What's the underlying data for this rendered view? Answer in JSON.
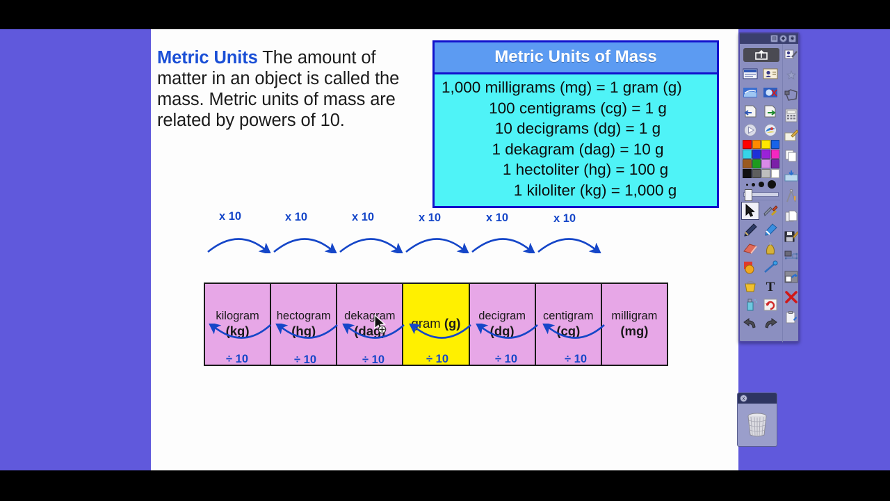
{
  "slide": {
    "paragraph": {
      "lead": "Metric Units",
      "body": "The amount of matter in an object is called the mass. Metric units of mass are related by powers of 10."
    },
    "table": {
      "title": "Metric Units of Mass",
      "rows": [
        "1,000 milligrams (mg) = 1 gram (g)",
        "100 centigrams (cg) = 1 g",
        "10 decigrams (dg) = 1 g",
        "1 dekagram (dag) = 10 g",
        "1 hectoliter (hg) = 100 g",
        "1 kiloliter (kg) = 1,000 g"
      ],
      "header_bg": "#5C9BF2",
      "body_bg": "#4FF3F7",
      "border": "#1111CC"
    },
    "chain": {
      "units": [
        {
          "name": "kilogram",
          "abbr": "(kg)",
          "highlight": false
        },
        {
          "name": "hectogram",
          "abbr": "(hg)",
          "highlight": false
        },
        {
          "name": "dekagram",
          "abbr": "(dag)",
          "highlight": false
        },
        {
          "name": "gram",
          "abbr": "(g)",
          "highlight": true
        },
        {
          "name": "decigram",
          "abbr": "(dg)",
          "highlight": false
        },
        {
          "name": "centigram",
          "abbr": "(cg)",
          "highlight": false
        },
        {
          "name": "milligram",
          "abbr": "(mg)",
          "highlight": false
        }
      ],
      "multiply_labels": [
        "x 10",
        "x 10",
        "x 10",
        "x 10",
        "x 10",
        "x 10"
      ],
      "divide_labels": [
        "÷ 10",
        "÷ 10",
        "÷ 10",
        "÷ 10",
        "÷ 10",
        "÷ 10"
      ],
      "arrow_color": "#1546C8",
      "cell_bg": "#E7A7E7",
      "highlight_bg": "#FFF000"
    }
  },
  "desktop": {
    "background": "#6059DC"
  },
  "toolbar": {
    "title_buttons": [
      "▤",
      "◆",
      "◉"
    ],
    "capture_button": "screen-capture",
    "swatches": [
      "#FF0000",
      "#FF8A00",
      "#FFE800",
      "#1763E8",
      "#36D4E8",
      "#1D2FD8",
      "#9A22D8",
      "#F527C1",
      "#9A5A20",
      "#1E9B1E",
      "#D98AE8",
      "#7B1FA8",
      "#111111",
      "#5E5E5E",
      "#BEBEBE",
      "#FFFFFF"
    ],
    "dot_sizes": [
      "3",
      "5",
      "8",
      "12"
    ],
    "left_icons": [
      "keyboard-icon",
      "contact-card-icon",
      "screen-shade-icon",
      "spotlight-icon",
      "page-back-icon",
      "page-forward-icon",
      "play-icon",
      "paint-icon",
      "select-arrow-icon",
      "tools-icon",
      "pen-icon",
      "highlighter-icon",
      "eraser-icon",
      "shape-icon",
      "fill-icon",
      "line-icon",
      "bucket-icon",
      "text-icon",
      "spray-icon",
      "reset-icon",
      "undo-icon",
      "redo-icon"
    ],
    "right_icons": [
      "signature-icon",
      "star-icon",
      "polygon-icon",
      "calculator-icon",
      "notes-icon",
      "copy-pages-icon",
      "folder-in-icon",
      "compass-icon",
      "pages-icon",
      "save-icon",
      "measure-icon",
      "capture-region-icon",
      "close-red-icon",
      "clipboard-icon"
    ],
    "selected_tool": "select-arrow-icon"
  },
  "trash": {
    "label": "recycle-bin",
    "close": "x"
  }
}
